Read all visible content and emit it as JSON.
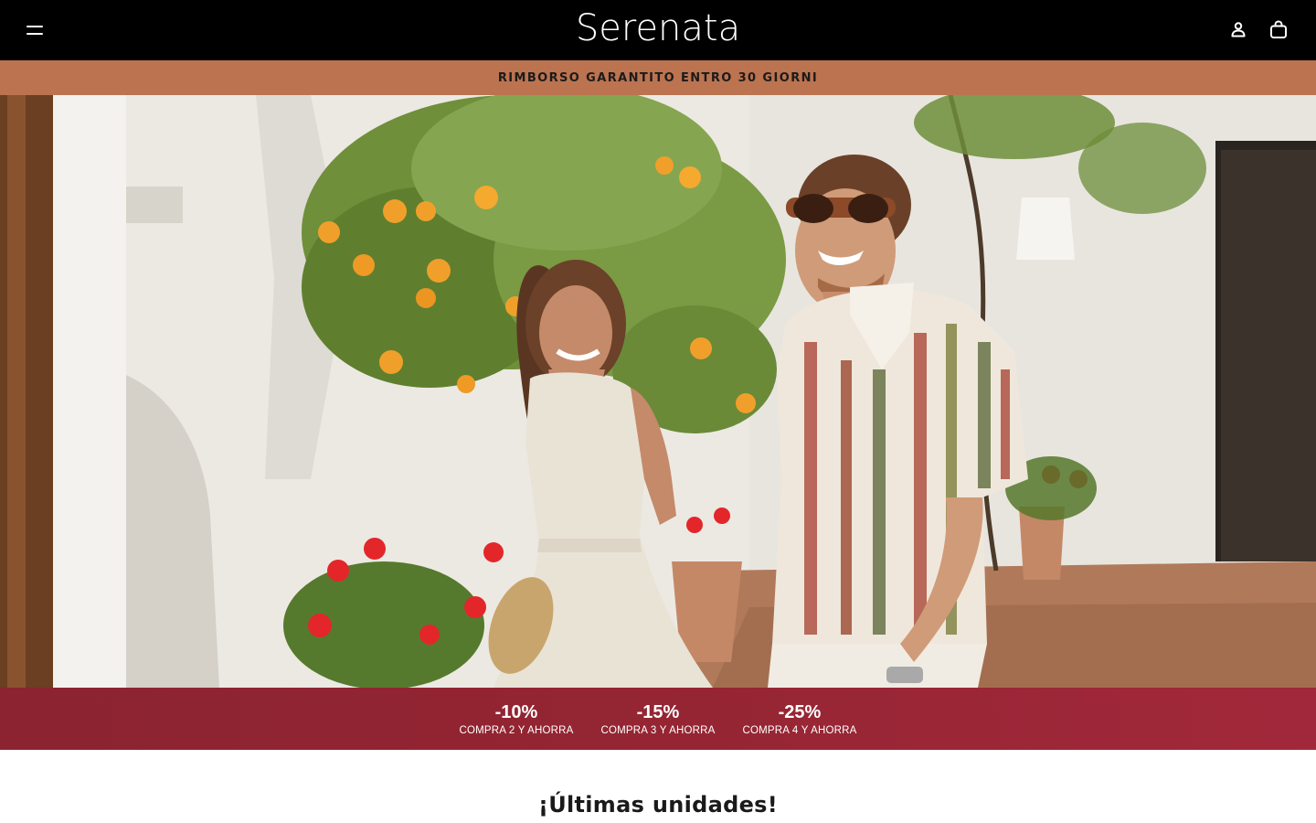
{
  "header": {
    "logo": "Serenata",
    "icons": {
      "menu": "hamburger-menu-icon",
      "account": "user-icon",
      "cart": "shopping-bag-icon"
    },
    "background_color": "#000000"
  },
  "announcement": {
    "text": "RIMBORSO GARANTITO ENTRO 30 GIORNI",
    "background_color": "#bc7350"
  },
  "hero": {
    "image": "hero-image"
  },
  "discounts": {
    "background_color": "#952533",
    "tiers": [
      {
        "percent": "-10%",
        "label": "COMPRA 2 Y AHORRA"
      },
      {
        "percent": "-15%",
        "label": "COMPRA 3 Y AHORRA"
      },
      {
        "percent": "-25%",
        "label": "COMPRA 4 Y AHORRA"
      }
    ]
  },
  "section": {
    "title": "¡Últimas unidades!"
  }
}
